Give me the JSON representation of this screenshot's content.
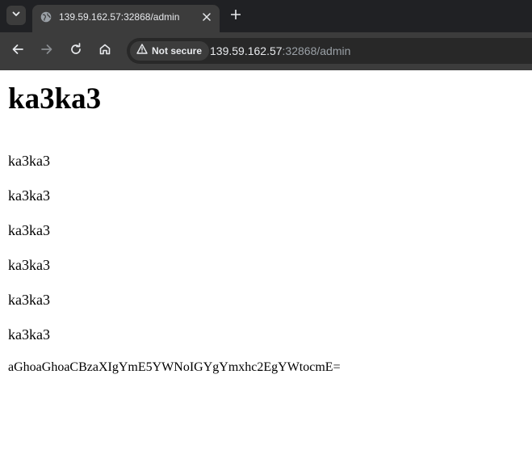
{
  "browser": {
    "tab": {
      "title": "139.59.162.57:32868/admin"
    },
    "omnibox": {
      "security_label": "Not secure",
      "url_host": "139.59.162.57",
      "url_rest": ":32868/admin"
    },
    "icons": {
      "tab_search": "chevron-down-icon",
      "tab_favicon": "globe-icon",
      "tab_close": "close-icon",
      "new_tab": "plus-icon",
      "back": "arrow-left-icon",
      "forward": "arrow-right-icon",
      "reload": "reload-icon",
      "home": "home-icon",
      "security": "warning-triangle-icon"
    },
    "colors": {
      "tabstrip_bg": "#202124",
      "toolbar_bg": "#3c3c3c",
      "omnibox_bg": "#282828",
      "text_primary": "#e8eaed",
      "text_secondary": "#9aa0a6"
    }
  },
  "page": {
    "heading": "ka3ka3",
    "paragraphs": [
      "ka3ka3",
      "ka3ka3",
      "ka3ka3",
      "ka3ka3",
      "ka3ka3",
      "ka3ka3"
    ],
    "encoded_text": "aGhoaGhoaCBzaXIgYmE5YWNoIGYgYmxhc2EgYWtocmE="
  }
}
